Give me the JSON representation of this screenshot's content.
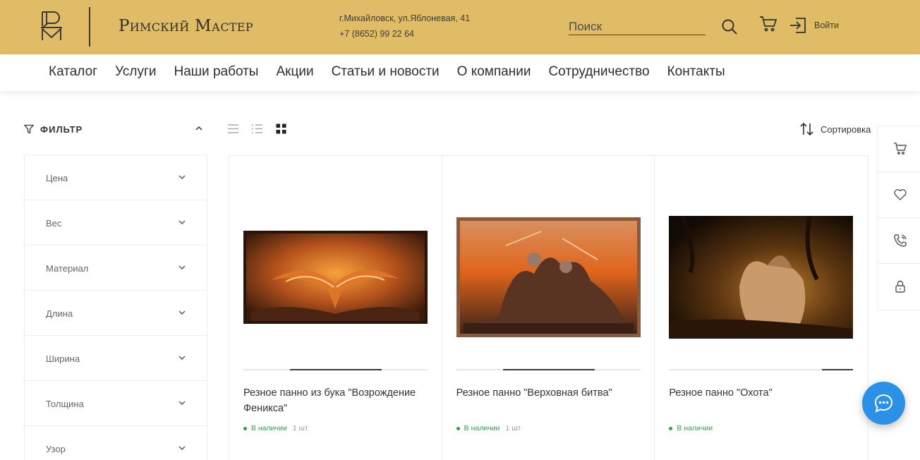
{
  "header": {
    "brand": "Римский Мастер",
    "address": "г.Михайловск, ул.Яблоневая, 41",
    "phone": "+7 (8652) 99 22 64",
    "search_placeholder": "Поиск",
    "login_label": "Войти",
    "bg_color": "#e0bc66"
  },
  "nav": {
    "items": [
      "Каталог",
      "Услуги",
      "Наши работы",
      "Акции",
      "Статьи и новости",
      "О компании",
      "Сотрудничество",
      "Контакты"
    ]
  },
  "filter": {
    "title": "ФИЛЬТР",
    "items": [
      "Цена",
      "Вес",
      "Материал",
      "Длина",
      "Ширина",
      "Толщина",
      "Узор"
    ]
  },
  "toolbar": {
    "sort_label": "Сортировка",
    "views": [
      "list-view-icon",
      "compact-list-view-icon",
      "grid-view-icon"
    ],
    "active_view": "grid-view-icon"
  },
  "products": [
    {
      "title": "Резное панно из бука \"Возрождение Феникса\"",
      "status": "В наличии",
      "qty": "1 шт",
      "image": "phoenix-carving-image",
      "gallery_position": 0.5
    },
    {
      "title": "Резное панно \"Верховная битва\"",
      "status": "В наличии",
      "qty": "1 шт",
      "image": "battle-carving-image",
      "gallery_position": 0.5
    },
    {
      "title": "Резное панно \"Охота\"",
      "status": "В наличии",
      "qty": "",
      "image": "hunting-carving-image",
      "gallery_position": 0.17
    }
  ],
  "colors": {
    "in_stock": "#33a34e",
    "chat_button": "#2a91e6"
  }
}
